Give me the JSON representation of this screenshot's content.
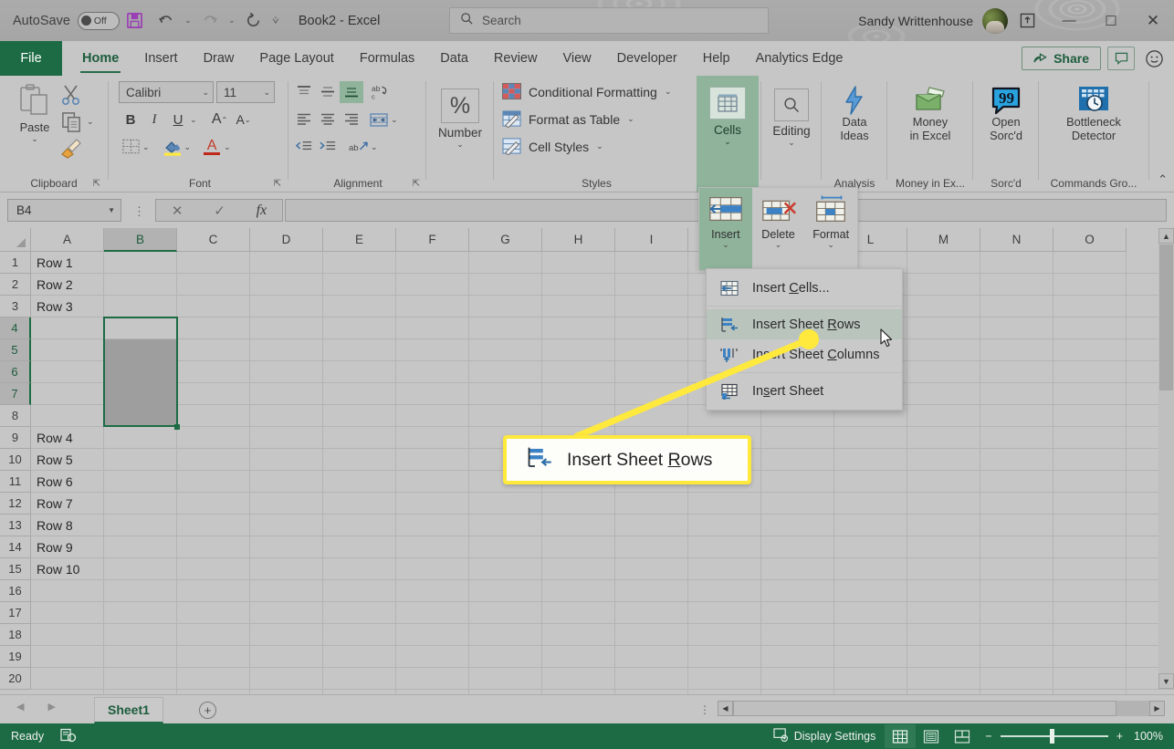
{
  "titlebar": {
    "autosave_label": "AutoSave",
    "autosave_state": "Off",
    "save_icon": "save-icon",
    "undo_icon": "undo-icon",
    "redo_icon": "redo-icon",
    "refresh_icon": "refresh-icon",
    "customize_icon": "customize-quick-access-icon",
    "document_title": "Book2  -  Excel",
    "user_name": "Sandy Writtenhouse",
    "ribbon_display_icon": "ribbon-display-options-icon",
    "minimize": "—",
    "maximize": "☐",
    "close": "✕"
  },
  "search": {
    "placeholder": "Search",
    "icon": "search-icon"
  },
  "tabs": {
    "file": "File",
    "items": [
      {
        "label": "Home",
        "active": true
      },
      {
        "label": "Insert",
        "active": false
      },
      {
        "label": "Draw",
        "active": false
      },
      {
        "label": "Page Layout",
        "active": false
      },
      {
        "label": "Formulas",
        "active": false
      },
      {
        "label": "Data",
        "active": false
      },
      {
        "label": "Review",
        "active": false
      },
      {
        "label": "View",
        "active": false
      },
      {
        "label": "Developer",
        "active": false
      },
      {
        "label": "Help",
        "active": false
      },
      {
        "label": "Analytics Edge",
        "active": false
      }
    ],
    "share": "Share",
    "comments_icon": "comment-icon",
    "feedback_icon": "smiley-face-icon"
  },
  "ribbon": {
    "clipboard": {
      "group_label": "Clipboard",
      "paste_label": "Paste",
      "cut_icon": "scissors-icon",
      "copy_icon": "copy-icon",
      "format_painter_icon": "format-painter-icon"
    },
    "font": {
      "group_label": "Font",
      "font_name": "Calibri",
      "font_size": "11",
      "bold": "B",
      "italic": "I",
      "underline": "U",
      "grow_font": "A",
      "shrink_font": "A",
      "borders_icon": "borders-icon",
      "fill_color_icon": "fill-color-icon",
      "font_color_icon": "font-color-icon"
    },
    "alignment": {
      "group_label": "Alignment",
      "top_align_icon": "align-top-icon",
      "middle_align_icon": "align-middle-icon",
      "bottom_align_icon": "align-bottom-icon",
      "orientation_icon": "orientation-icon",
      "align_left_icon": "align-left-icon",
      "align_center_icon": "align-center-icon",
      "align_right_icon": "align-right-icon",
      "merge_icon": "merge-and-center-icon",
      "decrease_indent_icon": "decrease-indent-icon",
      "increase_indent_icon": "increase-indent-icon",
      "wrap_text_icon": "wrap-text-icon"
    },
    "number": {
      "group_label": "",
      "label": "Number",
      "icon": "percent-icon"
    },
    "styles": {
      "group_label": "Styles",
      "items": [
        {
          "label": "Conditional Formatting",
          "icon": "conditional-formatting-icon"
        },
        {
          "label": "Format as Table",
          "icon": "format-as-table-icon"
        },
        {
          "label": "Cell Styles",
          "icon": "cell-styles-icon"
        }
      ]
    },
    "cells": {
      "group_label": "",
      "label": "Cells",
      "icon": "cells-icon"
    },
    "editing": {
      "group_label": "",
      "label": "Editing",
      "icon": "magnifier-icon"
    },
    "analysis": {
      "group_label": "Analysis",
      "label": "Data Ideas",
      "label_l1": "Data",
      "label_l2": "Ideas",
      "icon": "lightning-bolt-icon"
    },
    "money": {
      "group_label": "Money in Ex...",
      "label_l1": "Money",
      "label_l2": "in Excel",
      "icon": "money-wallet-icon"
    },
    "sorcd": {
      "group_label": "Sorc'd",
      "label_l1": "Open",
      "label_l2": "Sorc'd",
      "icon": "quote-bubble-icon"
    },
    "commands": {
      "group_label": "Commands Gro...",
      "label_l1": "Bottleneck",
      "label_l2": "Detector",
      "icon": "bottleneck-detector-icon"
    },
    "collapse_icon": "collapse-ribbon-icon"
  },
  "formula_bar": {
    "name_box_value": "B4",
    "cancel_icon": "cancel-icon",
    "enter_icon": "enter-checkmark-icon",
    "function_icon": "insert-function-fx-icon",
    "formula_value": ""
  },
  "grid": {
    "columns": [
      "A",
      "B",
      "C",
      "D",
      "E",
      "F",
      "G",
      "H",
      "I",
      "J",
      "K",
      "L",
      "M",
      "N",
      "O"
    ],
    "selected_column": "B",
    "rows": [
      "1",
      "2",
      "3",
      "4",
      "5",
      "6",
      "7",
      "8",
      "9",
      "10",
      "11",
      "12",
      "13",
      "14",
      "15",
      "16",
      "17",
      "18",
      "19",
      "20"
    ],
    "selected_rows": [
      "4",
      "5",
      "6",
      "7"
    ],
    "cell_values": [
      {
        "row": 1,
        "col": "A",
        "value": "Row 1"
      },
      {
        "row": 2,
        "col": "A",
        "value": "Row 2"
      },
      {
        "row": 3,
        "col": "A",
        "value": "Row 3"
      },
      {
        "row": 8,
        "col": "A",
        "value": "Row 4"
      },
      {
        "row": 9,
        "col": "A",
        "value": "Row 5"
      },
      {
        "row": 10,
        "col": "A",
        "value": "Row 6"
      },
      {
        "row": 11,
        "col": "A",
        "value": "Row 7"
      },
      {
        "row": 12,
        "col": "A",
        "value": "Row 8"
      },
      {
        "row": 13,
        "col": "A",
        "value": "Row 9"
      },
      {
        "row": 14,
        "col": "A",
        "value": "Row 10"
      }
    ],
    "selection_range": "B4:B7"
  },
  "cells_flyout": {
    "insert": {
      "label": "Insert",
      "icon": "insert-cells-icon",
      "active": true
    },
    "delete": {
      "label": "Delete",
      "icon": "delete-cells-icon",
      "active": false
    },
    "format": {
      "label": "Format",
      "icon": "format-cells-icon",
      "active": false
    }
  },
  "insert_menu": {
    "items": [
      {
        "label": "Insert Cells...",
        "accel_before": "",
        "accel": "",
        "icon": "insert-cells-menu-icon",
        "highlighted": false
      },
      {
        "label": "Insert Sheet Rows",
        "icon": "insert-sheet-rows-icon",
        "highlighted": true
      },
      {
        "label": "Insert Sheet Columns",
        "icon": "insert-sheet-columns-icon",
        "highlighted": false
      },
      {
        "label": "Insert Sheet",
        "icon": "insert-sheet-icon",
        "highlighted": false
      }
    ]
  },
  "callout": {
    "text": "Insert Sheet Rows",
    "icon": "insert-sheet-rows-icon",
    "border_color": "#ffe93d",
    "dot_color": "#ffe93d"
  },
  "sheet_bar": {
    "prev_icon": "prev-sheet-icon",
    "next_icon": "next-sheet-icon",
    "sheets": [
      "Sheet1"
    ],
    "active_sheet": "Sheet1",
    "add_sheet_icon": "add-sheet-icon"
  },
  "status_bar": {
    "status": "Ready",
    "recording_icon": "macro-record-icon",
    "display_settings": "Display Settings",
    "display_settings_icon": "display-settings-icon",
    "view_normal_icon": "normal-view-icon",
    "view_page_layout_icon": "page-layout-view-icon",
    "view_page_break_icon": "page-break-view-icon",
    "zoom_out": "−",
    "zoom_in": "+",
    "zoom_level": "100%"
  },
  "colors": {
    "excel_green": "#1d6b44",
    "status_bar": "#1d6b44",
    "ribbon_bg": "#c6c6c6",
    "highlight_green": "#8fb39b",
    "callout_yellow": "#ffe93d"
  }
}
